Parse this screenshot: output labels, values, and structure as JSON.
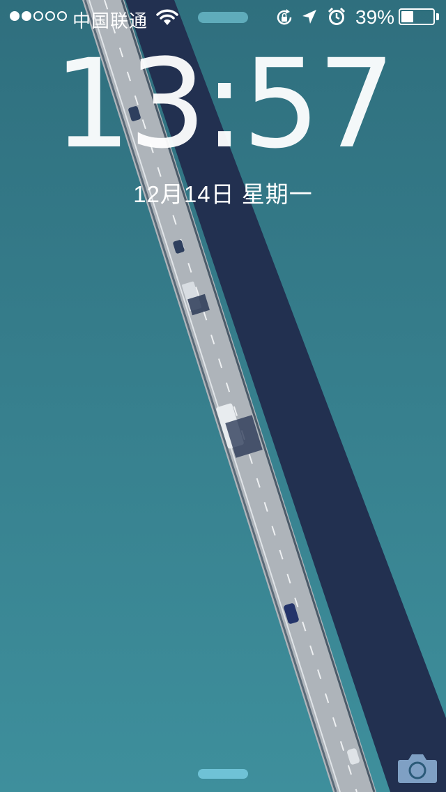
{
  "status_bar": {
    "signal_strength": 2,
    "signal_dots": 5,
    "carrier": "中国联通",
    "icons": [
      "wifi-icon",
      "rotation-lock-icon",
      "location-arrow-icon",
      "alarm-clock-icon"
    ],
    "battery_percent_label": "39%",
    "battery_level": 0.39
  },
  "lock_screen": {
    "time": "13:57",
    "date": "12月14日 星期一"
  },
  "bottom": {
    "icons": [
      "home-indicator",
      "camera-icon"
    ]
  },
  "colors": {
    "sea": "#3a7f8f",
    "shadow": "#233250",
    "road": "#aeb3b8",
    "accent": "#6fc2d6"
  }
}
